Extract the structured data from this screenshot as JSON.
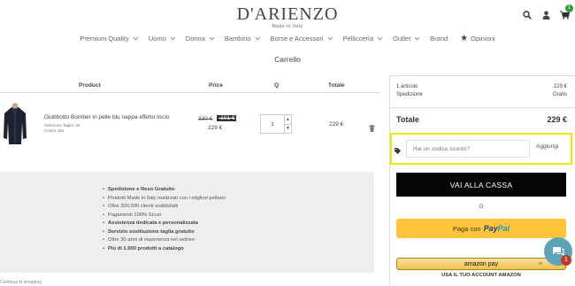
{
  "header": {
    "logo": "D'ARIENZO",
    "logo_sub": "Made in Italy",
    "cart_count": "1"
  },
  "nav": [
    {
      "label": "Premium Quality",
      "chevron": true
    },
    {
      "label": "Uomo",
      "chevron": true
    },
    {
      "label": "Donna",
      "chevron": true
    },
    {
      "label": "Bambino",
      "chevron": true
    },
    {
      "label": "Borse e Accessori",
      "chevron": true
    },
    {
      "label": "Pelliccerìa",
      "chevron": true
    },
    {
      "label": "Outlet",
      "chevron": true
    },
    {
      "label": "Brand",
      "chevron": false
    },
    {
      "label": "Opinioni",
      "chevron": false,
      "icon": "star-icon"
    }
  ],
  "page_title": "Carrello",
  "table": {
    "headers": {
      "product": "Product",
      "price": "Price",
      "qty": "Q",
      "total": "Totale"
    },
    "item": {
      "name": "Giubbotto Bomber in pelle blu nappa effetto liscio",
      "size": "Seleziona Taglia: 48",
      "color": "Colore: Blu",
      "old_price": "330 €",
      "discount": "-101 €",
      "price": "229 €",
      "quantity": "1",
      "total": "229 €"
    }
  },
  "features": [
    {
      "text": "Spedizione e Reso Gratuito",
      "bold": true
    },
    {
      "text": "Prodotti Made in Italy realizzati con i migliori pellami",
      "bold": false
    },
    {
      "text": "Oltre 300.000 clienti soddisfatti",
      "bold": false
    },
    {
      "text": "Pagamenti 100% Sicuri",
      "bold": false
    },
    {
      "text": "Assistenza dedicata e personalizzata",
      "bold": true
    },
    {
      "text": "Servizio sostituzione taglia gratuito",
      "bold": true
    },
    {
      "text": "Oltre 30 anni di esperienza nel settore",
      "bold": false
    },
    {
      "text": "Più di 1.000 prodotti a catalogo",
      "bold": true
    }
  ],
  "bottom_left": "Continua lo shopping",
  "summary": {
    "items_label": "1 articolo",
    "items_value": "229 €",
    "shipping_label": "Spedizione",
    "shipping_value": "Gratis",
    "total_label": "Totale",
    "total_value": "229 €",
    "coupon_placeholder": "Hai un codice sconto?",
    "coupon_button": "Aggiungi",
    "checkout_button": "VAI ALLA CASSA",
    "or_text": "O",
    "paypal_prefix": "Paga con",
    "paypal_logo_a": "Pay",
    "paypal_logo_b": "Pal",
    "amazon_logo": "amazon pay",
    "amazon_label": "USA IL TUO ACCOUNT AMAZON"
  },
  "chat": {
    "badge": "1"
  },
  "colors": {
    "highlight": "#f0ea00",
    "paypal": "#ffc439",
    "checkout": "#050505",
    "chat": "#5ca3b8"
  }
}
